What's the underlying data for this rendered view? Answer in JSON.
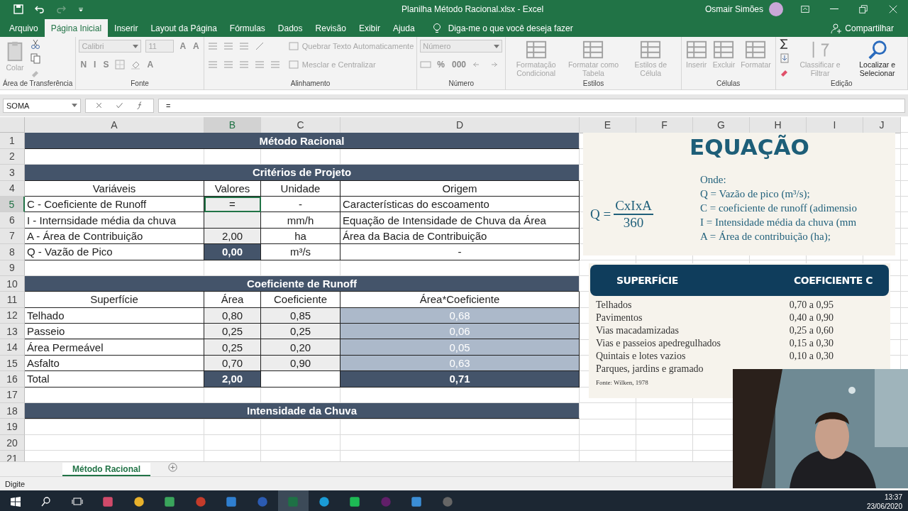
{
  "window": {
    "title": "Planilha Método Racional.xlsx  -  Excel",
    "user": "Osmair Simões"
  },
  "tabs": [
    {
      "label": "Arquivo",
      "selected": false
    },
    {
      "label": "Página Inicial",
      "selected": true
    },
    {
      "label": "Inserir",
      "selected": false
    },
    {
      "label": "Layout da Página",
      "selected": false
    },
    {
      "label": "Fórmulas",
      "selected": false
    },
    {
      "label": "Dados",
      "selected": false
    },
    {
      "label": "Revisão",
      "selected": false
    },
    {
      "label": "Exibir",
      "selected": false
    },
    {
      "label": "Ajuda",
      "selected": false
    }
  ],
  "tell_me": {
    "placeholder": "Diga-me o que você deseja fazer"
  },
  "share": "Compartilhar",
  "ribbon": {
    "groups": [
      {
        "kind": "clipboard",
        "label": "Área de Transferência",
        "buttons": [
          {
            "label": "Colar",
            "disabled": true
          }
        ]
      },
      {
        "kind": "font",
        "label": "Fonte",
        "font_name": "Calibri",
        "font_size": "11",
        "size_buttons": [
          "A",
          "A"
        ],
        "format_buttons": [
          "N",
          "I",
          "S"
        ],
        "color_button": "A"
      },
      {
        "kind": "alignment",
        "label": "Alinhamento",
        "buttons": [
          {
            "label": "Quebrar Texto Automaticamente",
            "disabled": true
          },
          {
            "label": "Mesclar e Centralizar",
            "disabled": true
          }
        ]
      },
      {
        "kind": "number",
        "label": "Número",
        "format": "Número",
        "buttons": [
          "%",
          "000"
        ]
      },
      {
        "kind": "styles",
        "label": "Estilos",
        "buttons": [
          {
            "label": "Formatação Condicional",
            "disabled": true
          },
          {
            "label": "Formatar como Tabela",
            "disabled": true
          },
          {
            "label": "Estilos de Célula",
            "disabled": true
          }
        ]
      },
      {
        "kind": "cells",
        "label": "Células",
        "buttons": [
          {
            "label": "Inserir",
            "disabled": true
          },
          {
            "label": "Excluir",
            "disabled": true
          },
          {
            "label": "Formatar",
            "disabled": true
          }
        ]
      },
      {
        "kind": "editing",
        "label": "Edição",
        "buttons": [
          {
            "label": "Classificar e Filtrar",
            "disabled": true
          },
          {
            "label": "Localizar e Selecionar",
            "disabled": false
          }
        ]
      }
    ]
  },
  "formula_bar": {
    "name_box": "SOMA",
    "formula": "="
  },
  "sheet": {
    "columns": [
      {
        "label": "A",
        "selected": false
      },
      {
        "label": "B",
        "selected": true
      },
      {
        "label": "C",
        "selected": false
      },
      {
        "label": "D",
        "selected": false
      },
      {
        "label": "E",
        "selected": false
      },
      {
        "label": "F",
        "selected": false
      },
      {
        "label": "G",
        "selected": false
      },
      {
        "label": "H",
        "selected": false
      },
      {
        "label": "I",
        "selected": false
      },
      {
        "label": "J",
        "selected": false
      }
    ],
    "rows": [
      {
        "number": "1",
        "selected": false,
        "kind": "section",
        "text": "Método Racional"
      },
      {
        "number": "2",
        "selected": false,
        "kind": "blank"
      },
      {
        "number": "3",
        "selected": false,
        "kind": "section",
        "text": "Critérios de Projeto"
      },
      {
        "number": "4",
        "selected": false,
        "kind": "header",
        "cells": [
          "Variáveis",
          "Valores",
          "Unidade",
          "Origem"
        ]
      },
      {
        "number": "5",
        "selected": true,
        "kind": "data",
        "cells": [
          {
            "text": "C - Coeficiente de Runoff",
            "kind": "left"
          },
          {
            "text": "=",
            "kind": "editing"
          },
          {
            "text": "-",
            "kind": "center"
          },
          {
            "text": "Características do escoamento",
            "kind": "left"
          }
        ]
      },
      {
        "number": "6",
        "selected": false,
        "kind": "data",
        "cells": [
          {
            "text": "I - Internsidade média da chuva",
            "kind": "left"
          },
          {
            "kind": "input"
          },
          {
            "text": "mm/h",
            "kind": "center"
          },
          {
            "text": "Equação de Intensidade de Chuva da Área",
            "kind": "left"
          }
        ]
      },
      {
        "number": "7",
        "selected": false,
        "kind": "data",
        "cells": [
          {
            "text": "A - Área de Contribuição",
            "kind": "left"
          },
          {
            "text": "2,00",
            "kind": "input"
          },
          {
            "text": "ha",
            "kind": "center"
          },
          {
            "text": "Área da Bacia de Contribuição",
            "kind": "left"
          }
        ]
      },
      {
        "number": "8",
        "selected": false,
        "kind": "data",
        "cells": [
          {
            "text": "Q - Vazão de Pico",
            "kind": "left"
          },
          {
            "text": "0,00",
            "kind": "result"
          },
          {
            "text": "m³/s",
            "kind": "center"
          },
          {
            "text": "-",
            "kind": "center"
          }
        ]
      },
      {
        "number": "9",
        "selected": false,
        "kind": "blank"
      },
      {
        "number": "10",
        "selected": false,
        "kind": "section",
        "text": "Coeficiente de Runoff"
      },
      {
        "number": "11",
        "selected": false,
        "kind": "header",
        "cells": [
          "Superfície",
          "Área",
          "Coeficiente",
          "Área*Coeficiente"
        ]
      },
      {
        "number": "12",
        "selected": false,
        "kind": "data",
        "cells": [
          {
            "text": "Telhado",
            "kind": "left"
          },
          {
            "text": "0,80",
            "kind": "input"
          },
          {
            "text": "0,85",
            "kind": "input"
          },
          {
            "text": "0,68",
            "kind": "computed"
          }
        ]
      },
      {
        "number": "13",
        "selected": false,
        "kind": "data",
        "cells": [
          {
            "text": "Passeio",
            "kind": "left"
          },
          {
            "text": "0,25",
            "kind": "input"
          },
          {
            "text": "0,25",
            "kind": "input"
          },
          {
            "text": "0,06",
            "kind": "computed"
          }
        ]
      },
      {
        "number": "14",
        "selected": false,
        "kind": "data",
        "cells": [
          {
            "text": "Área Permeável",
            "kind": "left"
          },
          {
            "text": "0,25",
            "kind": "input"
          },
          {
            "text": "0,20",
            "kind": "input"
          },
          {
            "text": "0,05",
            "kind": "computed"
          }
        ]
      },
      {
        "number": "15",
        "selected": false,
        "kind": "data",
        "cells": [
          {
            "text": "Asfalto",
            "kind": "left"
          },
          {
            "text": "0,70",
            "kind": "input"
          },
          {
            "text": "0,90",
            "kind": "input"
          },
          {
            "text": "0,63",
            "kind": "computed"
          }
        ]
      },
      {
        "number": "16",
        "selected": false,
        "kind": "data",
        "cells": [
          {
            "text": "Total",
            "kind": "left"
          },
          {
            "text": "2,00",
            "kind": "result"
          },
          {
            "kind": "center"
          },
          {
            "text": "0,71",
            "kind": "result"
          }
        ]
      },
      {
        "number": "17",
        "selected": false,
        "kind": "blank"
      },
      {
        "number": "18",
        "selected": false,
        "kind": "section",
        "text": "Intensidade da Chuva"
      },
      {
        "number": "19",
        "selected": false,
        "kind": "blank"
      },
      {
        "number": "20",
        "selected": false,
        "kind": "blank"
      },
      {
        "number": "21",
        "selected": false,
        "kind": "blank"
      }
    ]
  },
  "equation_image": {
    "title": "EQUAÇÃO",
    "lhs": "Q =",
    "numerator": "CxIxA",
    "denominator": "360",
    "legend": [
      "Onde:",
      "Q = Vazão de pico (m³/s);",
      "C = coeficiente de runoff (adimensio",
      "I = Intensidade média da chuva (mm",
      "A = Área de contribuição (ha);"
    ]
  },
  "coefficient_image": {
    "headers": [
      "SUPERFÍCIE",
      "COEFICIENTE C"
    ],
    "rows": [
      {
        "surface": "Telhados",
        "range": "0,70 a 0,95"
      },
      {
        "surface": "Pavimentos",
        "range": "0,40 a 0,90"
      },
      {
        "surface": "Vias macadamizadas",
        "range": "0,25 a 0,60"
      },
      {
        "surface": "Vias e passeios apedregulhados",
        "range": "0,15 a 0,30"
      },
      {
        "surface": "Quintais e lotes vazios",
        "range": "0,10 a 0,30"
      },
      {
        "surface": "Parques, jardins e gramado"
      }
    ],
    "source": "Fonte: Wilken, 1978"
  },
  "sheet_tabs": [
    {
      "label": "Método Racional",
      "selected": true
    }
  ],
  "status_bar": {
    "mode": "Digite"
  },
  "taskbar": {
    "time": "13:37",
    "date": "23/06/2020"
  }
}
